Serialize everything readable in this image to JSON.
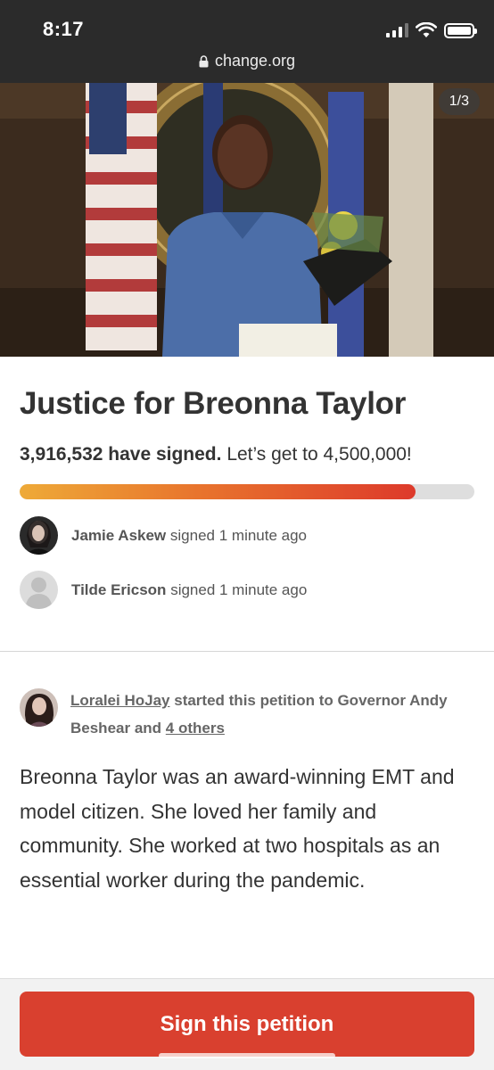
{
  "status_bar": {
    "time": "8:17"
  },
  "browser": {
    "url": "change.org"
  },
  "hero": {
    "counter": "1/3"
  },
  "petition": {
    "title": "Justice for Breonna Taylor",
    "signed_count": "3,916,532 have signed.",
    "goal_text": "Let’s get to 4,500,000!",
    "progress_fraction": 0.87
  },
  "recent_signers": [
    {
      "name": "Jamie Askew",
      "action": "signed 1 minute ago"
    },
    {
      "name": "Tilde Ericson",
      "action": "signed 1 minute ago"
    }
  ],
  "starter": {
    "name": "Loralei HoJay",
    "text_mid": "started this petition to Governor Andy Beshear and",
    "others_link": "4 others"
  },
  "description": "Breonna Taylor was an award-winning EMT and model citizen. She loved her family and community. She worked at two hospitals as an essential worker during the pandemic.",
  "cta": {
    "label": "Sign this petition"
  },
  "colors": {
    "primary_red": "#d9402f",
    "progress_start": "#eeaa38",
    "progress_end": "#dd3a2b",
    "top_bar": "#2b2b2b"
  }
}
